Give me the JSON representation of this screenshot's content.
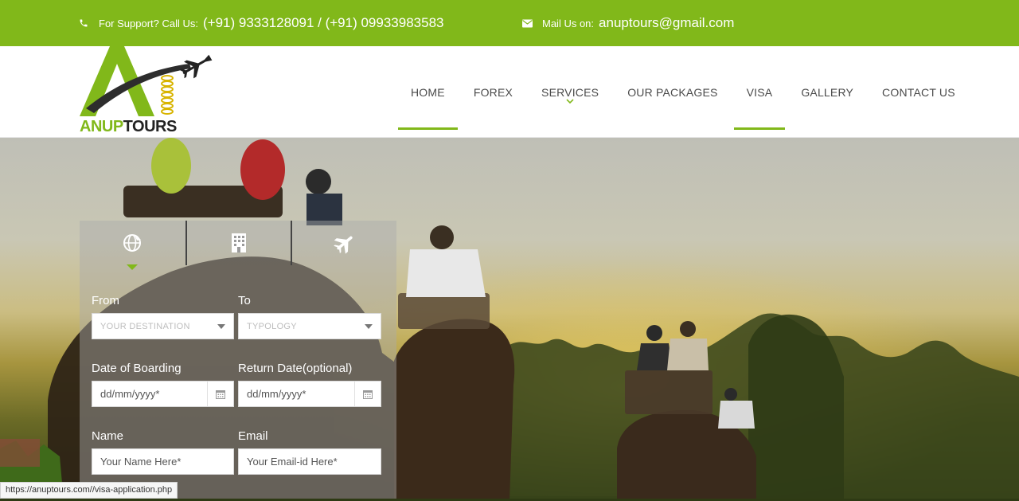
{
  "topbar": {
    "support_label": "For Support? Call Us:",
    "support_phone": "(+91) 9333128091 / (+91) 09933983583",
    "mail_label": "Mail Us on:",
    "mail_value": "anuptours@gmail.com",
    "phone_icon": "phone-icon",
    "mail_icon": "mail-icon"
  },
  "logo": {
    "part1": "ANUP",
    "part2": "TOURS"
  },
  "nav": {
    "home": "HOME",
    "forex": "FOREX",
    "services": "SERVICES",
    "packages": "OUR PACKAGES",
    "visa": "VISA",
    "gallery": "GALLERY",
    "contact": "CONTACT US"
  },
  "booking": {
    "tabs": [
      "globe-icon",
      "hotel-icon",
      "plane-icon"
    ],
    "from_label": "From",
    "to_label": "To",
    "from_placeholder": "YOUR DESTINATION",
    "to_placeholder": "TYPOLOGY",
    "boarding_label": "Date of Boarding",
    "return_label": "Return Date(optional)",
    "boarding_placeholder": "dd/mm/yyyy*",
    "return_placeholder": "dd/mm/yyyy*",
    "name_label": "Name",
    "email_label": "Email",
    "name_placeholder": "Your Name Here*",
    "email_placeholder": "Your Email-id Here*"
  },
  "status_url": "https://anuptours.com//visa-application.php",
  "colors": {
    "accent": "#81b81a",
    "topbar": "#81b81a"
  }
}
